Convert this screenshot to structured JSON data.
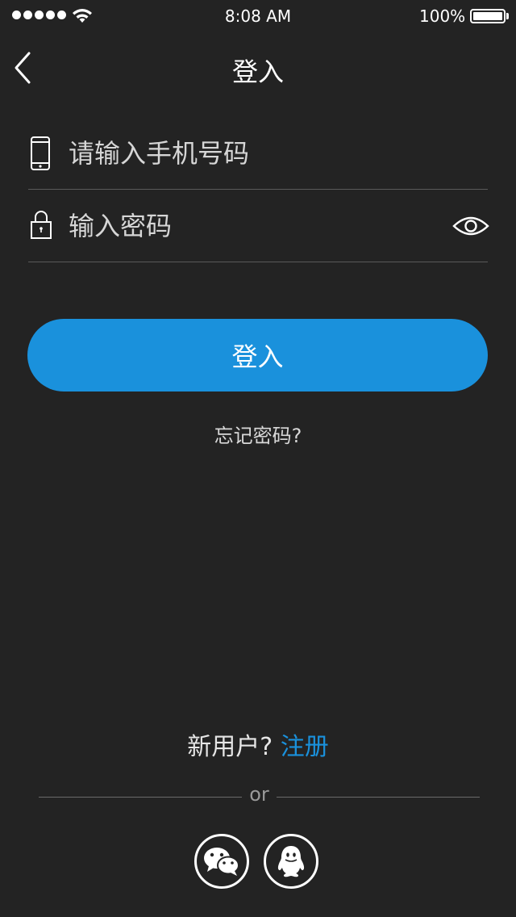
{
  "status_bar": {
    "time": "8:08 AM",
    "battery_percent": "100%",
    "battery_level": 1.0,
    "signal_bars": 5
  },
  "nav": {
    "title": "登入",
    "back_icon": "chevron-left-icon"
  },
  "form": {
    "phone": {
      "placeholder": "请输入手机号码",
      "value": "",
      "icon": "smartphone-icon"
    },
    "password": {
      "placeholder": "输入密码",
      "value": "",
      "icon": "lock-icon",
      "toggle_icon": "eye-icon"
    },
    "submit_label": "登入",
    "forgot_label": "忘记密码?"
  },
  "register": {
    "prompt": "新用户?",
    "link_label": "注册"
  },
  "social": {
    "divider_text": "or",
    "providers": [
      {
        "icon": "wechat-icon"
      },
      {
        "icon": "qq-icon"
      }
    ]
  },
  "colors": {
    "background": "#232323",
    "accent": "#1a91dc",
    "text": "#ffffff",
    "divider": "#5a5a5a"
  }
}
